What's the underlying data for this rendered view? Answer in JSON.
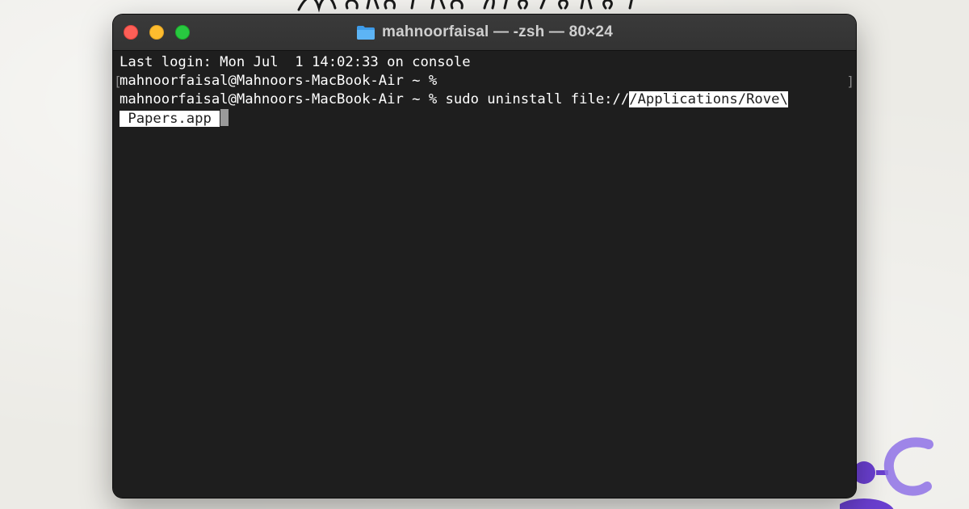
{
  "window": {
    "title": "mahnoorfaisal — -zsh — 80×24",
    "title_icon": "folder-icon",
    "traffic_lights": {
      "close_color": "#fe5f57",
      "minimize_color": "#febc2e",
      "zoom_color": "#28c840"
    }
  },
  "terminal": {
    "background": "#1e1e1e",
    "foreground": "#ffffff",
    "lines": [
      "Last login: Mon Jul  1 14:02:33 on console",
      "mahnoorfaisal@Mahnoors-MacBook-Air ~ %",
      "mahnoorfaisal@Mahnoors-MacBook-Air ~ % sudo uninstall file://",
      "/Applications/Rove\\",
      " Papers.app "
    ],
    "selected_text_color": "#ffffff",
    "mark_left": "[",
    "mark_right": "]"
  }
}
